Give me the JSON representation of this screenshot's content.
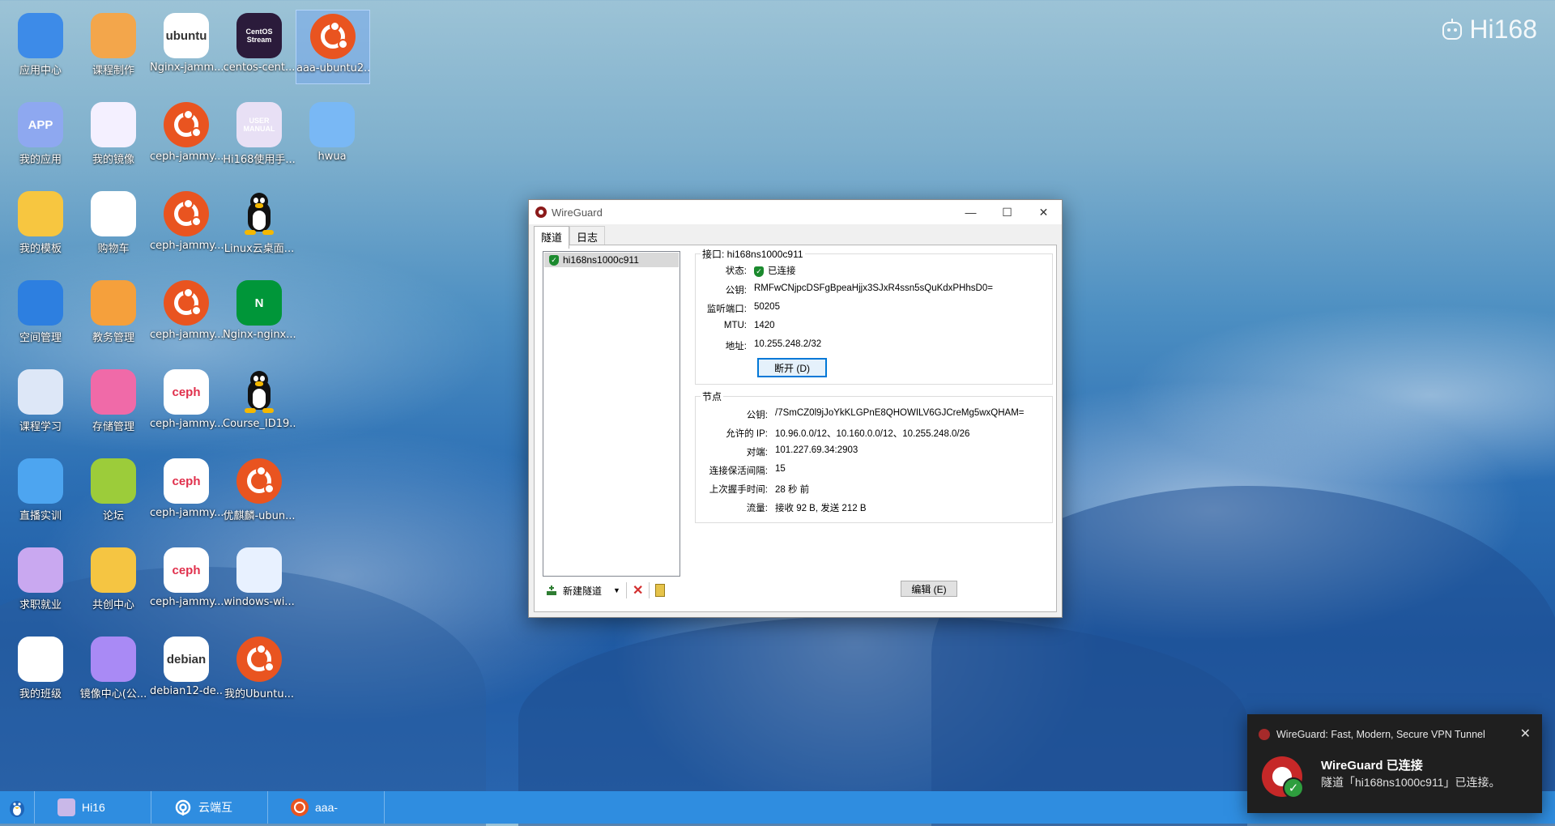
{
  "brand": {
    "logo_text": "Hi168"
  },
  "desktop": {
    "icons": [
      {
        "label": "应用中心",
        "icon": "app-store-icon"
      },
      {
        "label": "课程制作",
        "icon": "course-make-icon"
      },
      {
        "label": "Nginx-jamm...",
        "icon": "ubuntu-logo-icon",
        "text": "ubuntu"
      },
      {
        "label": "centos-cent...",
        "icon": "centos-icon",
        "text": "CentOS Stream"
      },
      {
        "label": "aaa-ubuntu2...",
        "icon": "ubuntu-icon"
      },
      {
        "label": "我的应用",
        "icon": "my-apps-icon",
        "text": "APP"
      },
      {
        "label": "我的镜像",
        "icon": "my-images-icon"
      },
      {
        "label": "ceph-jammy...",
        "icon": "ubuntu-icon"
      },
      {
        "label": "Hi168使用手...",
        "icon": "manual-icon",
        "text": "USER MANUAL"
      },
      {
        "label": "hwua",
        "icon": "paint-bucket-icon"
      },
      {
        "label": "我的模板",
        "icon": "folder-icon"
      },
      {
        "label": "购物车",
        "icon": "cart-icon"
      },
      {
        "label": "ceph-jammy...",
        "icon": "ubuntu-icon"
      },
      {
        "label": "Linux云桌面...",
        "icon": "tux-icon"
      },
      {
        "label": "空间管理",
        "icon": "space-manage-icon"
      },
      {
        "label": "教务管理",
        "icon": "academic-icon"
      },
      {
        "label": "ceph-jammy...",
        "icon": "ubuntu-icon"
      },
      {
        "label": "Nginx-nginx...",
        "icon": "nginx-icon",
        "text": "N"
      },
      {
        "label": "课程学习",
        "icon": "course-study-icon"
      },
      {
        "label": "存储管理",
        "icon": "storage-icon"
      },
      {
        "label": "ceph-jammy...",
        "icon": "ceph-icon",
        "text": "ceph"
      },
      {
        "label": "Course_ID19...",
        "icon": "tux-icon"
      },
      {
        "label": "直播实训",
        "icon": "live-icon"
      },
      {
        "label": "论坛",
        "icon": "forum-icon"
      },
      {
        "label": "ceph-jammy...",
        "icon": "ceph-icon",
        "text": "ceph"
      },
      {
        "label": "优麒麟-ubun...",
        "icon": "ubuntu-icon"
      },
      {
        "label": "求职就业",
        "icon": "job-icon"
      },
      {
        "label": "共创中心",
        "icon": "cocreate-icon"
      },
      {
        "label": "ceph-jammy...",
        "icon": "ceph-icon",
        "text": "ceph"
      },
      {
        "label": "windows-wi...",
        "icon": "windows-icon"
      },
      {
        "label": "我的班级",
        "icon": "my-class-icon"
      },
      {
        "label": "镜像中心(公...",
        "icon": "image-center-icon"
      },
      {
        "label": "debian12-de...",
        "icon": "debian-icon",
        "text": "debian"
      },
      {
        "label": "我的Ubuntu...",
        "icon": "ubuntu-icon"
      }
    ]
  },
  "wireguard": {
    "title": "WireGuard",
    "tabs": [
      "隧道",
      "日志"
    ],
    "tunnel_name": "hi168ns1000c911",
    "interface": {
      "group_label": "接口: hi168ns1000c911",
      "status_key": "状态:",
      "status_val": "已连接",
      "pubkey_key": "公钥:",
      "pubkey_val": "RMFwCNjpcDSFgBpeaHjjx3SJxR4ssn5sQuKdxPHhsD0=",
      "port_key": "监听端口:",
      "port_val": "50205",
      "mtu_key": "MTU:",
      "mtu_val": "1420",
      "addr_key": "地址:",
      "addr_val": "10.255.248.2/32",
      "disconnect": "断开 (D)"
    },
    "peer": {
      "group_label": "节点",
      "pubkey_key": "公钥:",
      "pubkey_val": "/7SmCZ0l9jJoYkKLGPnE8QHOWILV6GJCreMg5wxQHAM=",
      "allowed_key": "允许的 IP:",
      "allowed_val": "10.96.0.0/12、10.160.0.0/12、10.255.248.0/26",
      "endpoint_key": "对端:",
      "endpoint_val": "101.227.69.34:2903",
      "keepalive_key": "连接保活间隔:",
      "keepalive_val": "15",
      "handshake_key": "上次握手时间:",
      "handshake_val": "28 秒 前",
      "transfer_key": "流量:",
      "transfer_val": "接收 92 B, 发送 212 B"
    },
    "new_tunnel": "新建隧道",
    "edit": "编辑 (E)"
  },
  "taskbar": {
    "items": [
      {
        "label": "Hi16",
        "icon": "manual-icon"
      },
      {
        "label": "云端互",
        "icon": "cloud-connect-icon"
      },
      {
        "label": "aaa-",
        "icon": "ubuntu-icon"
      }
    ]
  },
  "notification": {
    "app": "WireGuard: Fast, Modern, Secure VPN Tunnel",
    "title": "WireGuard 已连接",
    "body": "隧道「hi168ns1000c911」已连接。"
  }
}
